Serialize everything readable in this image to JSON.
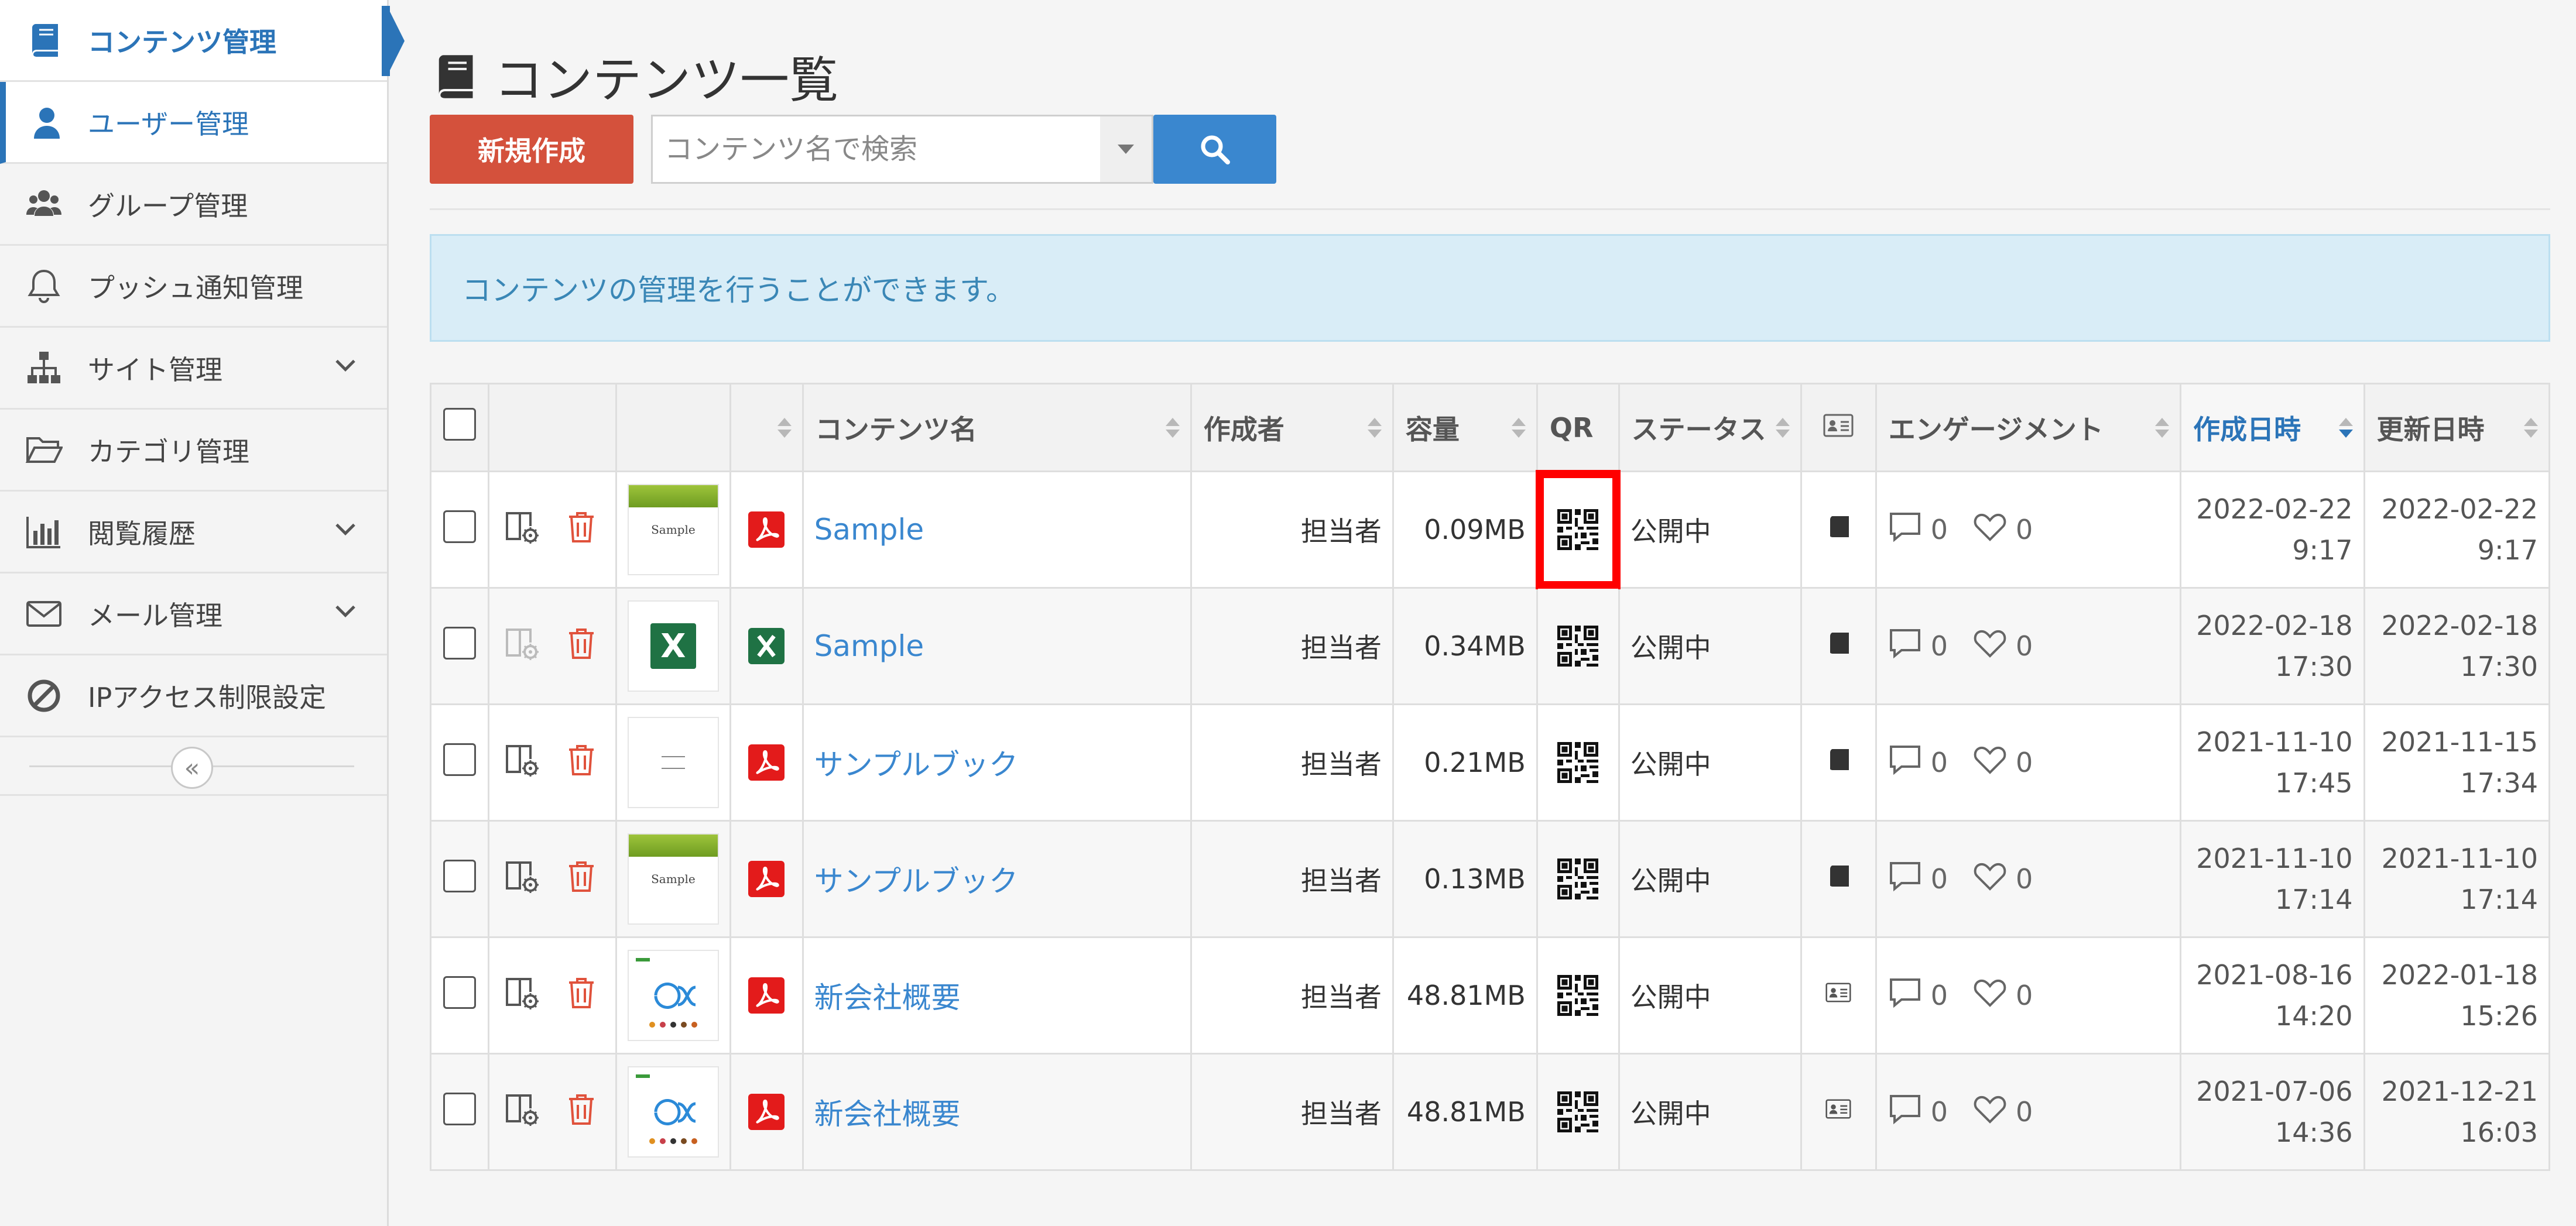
{
  "sidebar": {
    "items": [
      {
        "label": "コンテンツ管理",
        "icon": "book-icon"
      },
      {
        "label": "ユーザー管理",
        "icon": "user-icon"
      },
      {
        "label": "グループ管理",
        "icon": "users-icon"
      },
      {
        "label": "プッシュ通知管理",
        "icon": "bell-icon"
      },
      {
        "label": "サイト管理",
        "icon": "sitemap-icon"
      },
      {
        "label": "カテゴリ管理",
        "icon": "folder-open-icon"
      },
      {
        "label": "閲覧履歴",
        "icon": "bar-chart-icon"
      },
      {
        "label": "メール管理",
        "icon": "envelope-icon"
      },
      {
        "label": "IPアクセス制限設定",
        "icon": "ban-icon"
      }
    ],
    "collapse_glyph": "«"
  },
  "page": {
    "title": "コンテンツ一覧",
    "new_button": "新規作成",
    "search_placeholder": "コンテンツ名で検索",
    "info": "コンテンツの管理を行うことができます。"
  },
  "table": {
    "headers": {
      "name": "コンテンツ名",
      "author": "作成者",
      "size": "容量",
      "qr": "QR",
      "status": "ステータス",
      "engagement": "エンゲージメント",
      "created": "作成日時",
      "updated": "更新日時"
    },
    "rows": [
      {
        "thumb": "Sample",
        "type": "pdf-icon",
        "name": "Sample",
        "author": "担当者",
        "size": "0.09MB",
        "status": "公開中",
        "comments": "0",
        "likes": "0",
        "created_date": "2022-02-22",
        "created_time": "9:17",
        "updated_date": "2022-02-22",
        "updated_time": "9:17"
      },
      {
        "thumb": "X",
        "type": "excel-icon",
        "name": "Sample",
        "author": "担当者",
        "size": "0.34MB",
        "status": "公開中",
        "comments": "0",
        "likes": "0",
        "created_date": "2022-02-18",
        "created_time": "17:30",
        "updated_date": "2022-02-18",
        "updated_time": "17:30"
      },
      {
        "thumb": "",
        "type": "pdf-icon",
        "name": "サンプルブック",
        "author": "担当者",
        "size": "0.21MB",
        "status": "公開中",
        "comments": "0",
        "likes": "0",
        "created_date": "2021-11-10",
        "created_time": "17:45",
        "updated_date": "2021-11-15",
        "updated_time": "17:34"
      },
      {
        "thumb": "Sample",
        "type": "pdf-icon",
        "name": "サンプルブック",
        "author": "担当者",
        "size": "0.13MB",
        "status": "公開中",
        "comments": "0",
        "likes": "0",
        "created_date": "2021-11-10",
        "created_time": "17:14",
        "updated_date": "2021-11-10",
        "updated_time": "17:14"
      },
      {
        "thumb": "",
        "type": "pdf-icon",
        "name": "新会社概要",
        "author": "担当者",
        "size": "48.81MB",
        "status": "公開中",
        "comments": "0",
        "likes": "0",
        "created_date": "2021-08-16",
        "created_time": "14:20",
        "updated_date": "2022-01-18",
        "updated_time": "15:26"
      },
      {
        "thumb": "",
        "type": "pdf-icon",
        "name": "新会社概要",
        "author": "担当者",
        "size": "48.81MB",
        "status": "公開中",
        "comments": "0",
        "likes": "0",
        "created_date": "2021-07-06",
        "created_time": "14:36",
        "updated_date": "2021-12-21",
        "updated_time": "16:03"
      }
    ]
  },
  "colors": {
    "accent": "#2b74b8",
    "new_button": "#d4513c",
    "search_button": "#3a87cf",
    "highlight": "#ff0000",
    "info_bg": "#d9edf7"
  }
}
